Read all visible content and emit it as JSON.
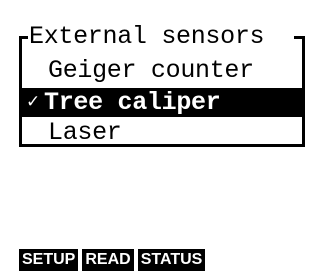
{
  "menu": {
    "title": "External sensors",
    "items": [
      {
        "label": "Geiger counter",
        "checked": false,
        "selected": false
      },
      {
        "label": "Tree caliper",
        "checked": true,
        "selected": true,
        "check_glyph": "✓"
      },
      {
        "label": "Laser",
        "checked": false,
        "selected": false
      }
    ]
  },
  "softkeys": [
    {
      "label": "SETUP"
    },
    {
      "label": "READ"
    },
    {
      "label": "STATUS"
    }
  ],
  "colors": {
    "background": "#ffffff",
    "foreground": "#000000",
    "highlight": "#000000",
    "highlight_text": "#ffffff"
  }
}
